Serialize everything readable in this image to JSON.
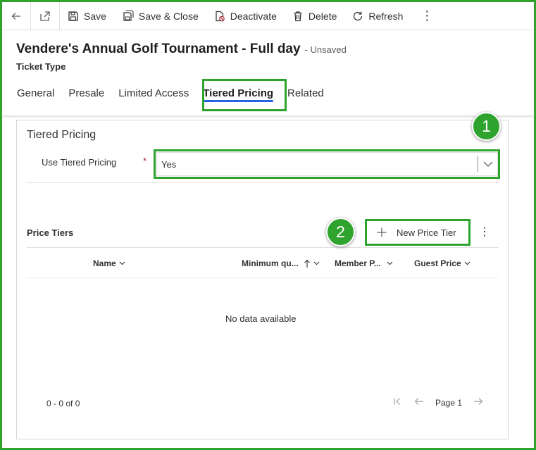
{
  "toolbar": {
    "save": "Save",
    "save_close": "Save & Close",
    "deactivate": "Deactivate",
    "delete": "Delete",
    "refresh": "Refresh",
    "more": "⋮"
  },
  "header": {
    "title": "Vendere's Annual Golf Tournament - Full day",
    "status": "- Unsaved",
    "entity": "Ticket Type"
  },
  "tabs": [
    "General",
    "Presale",
    "Limited Access",
    "Tiered Pricing",
    "Related"
  ],
  "active_tab": "Tiered Pricing",
  "section": {
    "title": "Tiered Pricing",
    "field_label": "Use Tiered Pricing",
    "required_mark": "*",
    "field_value": "Yes"
  },
  "grid": {
    "title": "Price Tiers",
    "new_button": "New Price Tier",
    "more": "⋮",
    "columns": [
      "Name",
      "Minimum qu...",
      "Member P...",
      "Guest Price"
    ],
    "empty_text": "No data available",
    "count": "0 - 0 of 0",
    "page_label": "Page 1"
  },
  "callouts": [
    "1",
    "2"
  ],
  "colors": {
    "highlight": "#2ea32e",
    "tab_underline": "#2266e3",
    "required": "#a4262c"
  }
}
